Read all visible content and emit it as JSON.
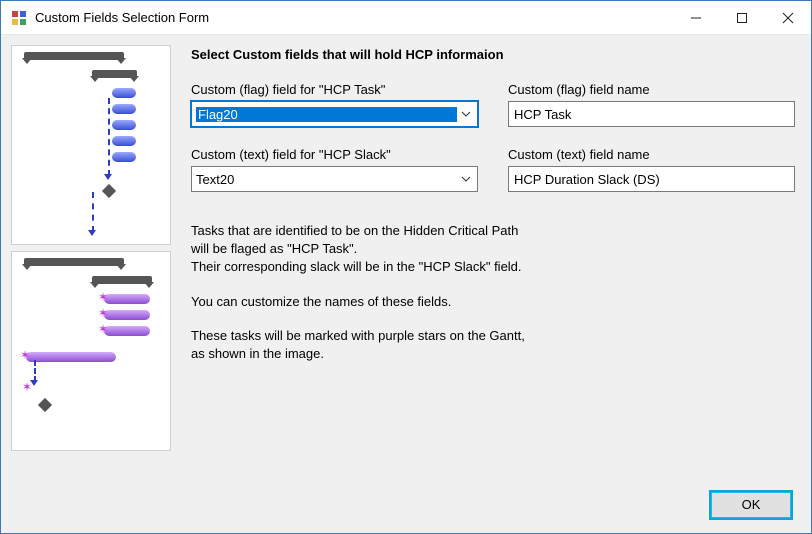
{
  "window": {
    "title": "Custom Fields Selection Form"
  },
  "form": {
    "heading": "Select Custom fields that will hold HCP informaion",
    "flag_field": {
      "label": "Custom (flag) field for \"HCP Task\"",
      "selected": "Flag20"
    },
    "flag_name": {
      "label": "Custom (flag) field name",
      "value": "HCP Task"
    },
    "text_field": {
      "label": "Custom (text) field  for \"HCP Slack\"",
      "selected": "Text20"
    },
    "text_name": {
      "label": "Custom (text) field name",
      "value": "HCP Duration Slack (DS)"
    },
    "description": {
      "p1a": "Tasks that are identified to be on the Hidden Critical Path",
      "p1b": "will be flaged as \"HCP Task\".",
      "p1c": "Their corresponding slack will be in the \"HCP Slack\" field.",
      "p2": "You can customize the names of these fields.",
      "p3a": "These tasks will be marked with purple stars on the Gantt,",
      "p3b": "as shown in the image."
    },
    "ok_label": "OK"
  }
}
